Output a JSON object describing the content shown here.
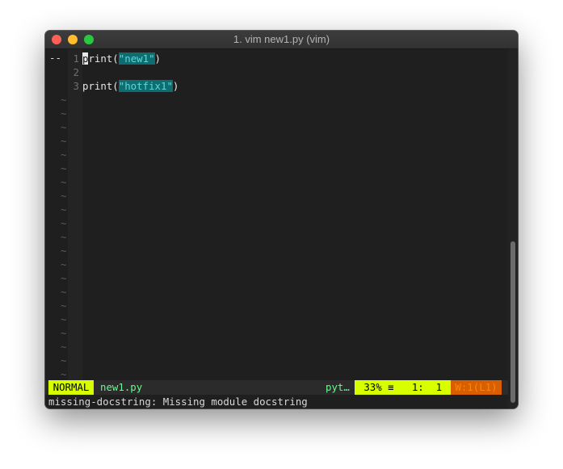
{
  "window": {
    "title": "1. vim new1.py (vim)"
  },
  "editor": {
    "sign": "--",
    "lines": [
      {
        "num": "1",
        "cursor_char": "p",
        "before": "rint(",
        "string": "\"new1\"",
        "after": ")"
      },
      {
        "num": "2",
        "text": ""
      },
      {
        "num": "3",
        "before": "print(",
        "string": "\"hotfix1\"",
        "after": ")"
      }
    ],
    "tilde": "~"
  },
  "statusline": {
    "mode": "NORMAL",
    "filename": "new1.py",
    "filetype": "pyt…",
    "percent": "33% ≡",
    "position": "1:  1",
    "warning": "W:1(L1)"
  },
  "cmdline": {
    "message": "missing-docstring: Missing module docstring"
  },
  "colors": {
    "mode_bg": "#d7ff00",
    "warning_bg": "#d75f00",
    "string_bg": "#0e6d70",
    "filename": "#5fff87"
  }
}
